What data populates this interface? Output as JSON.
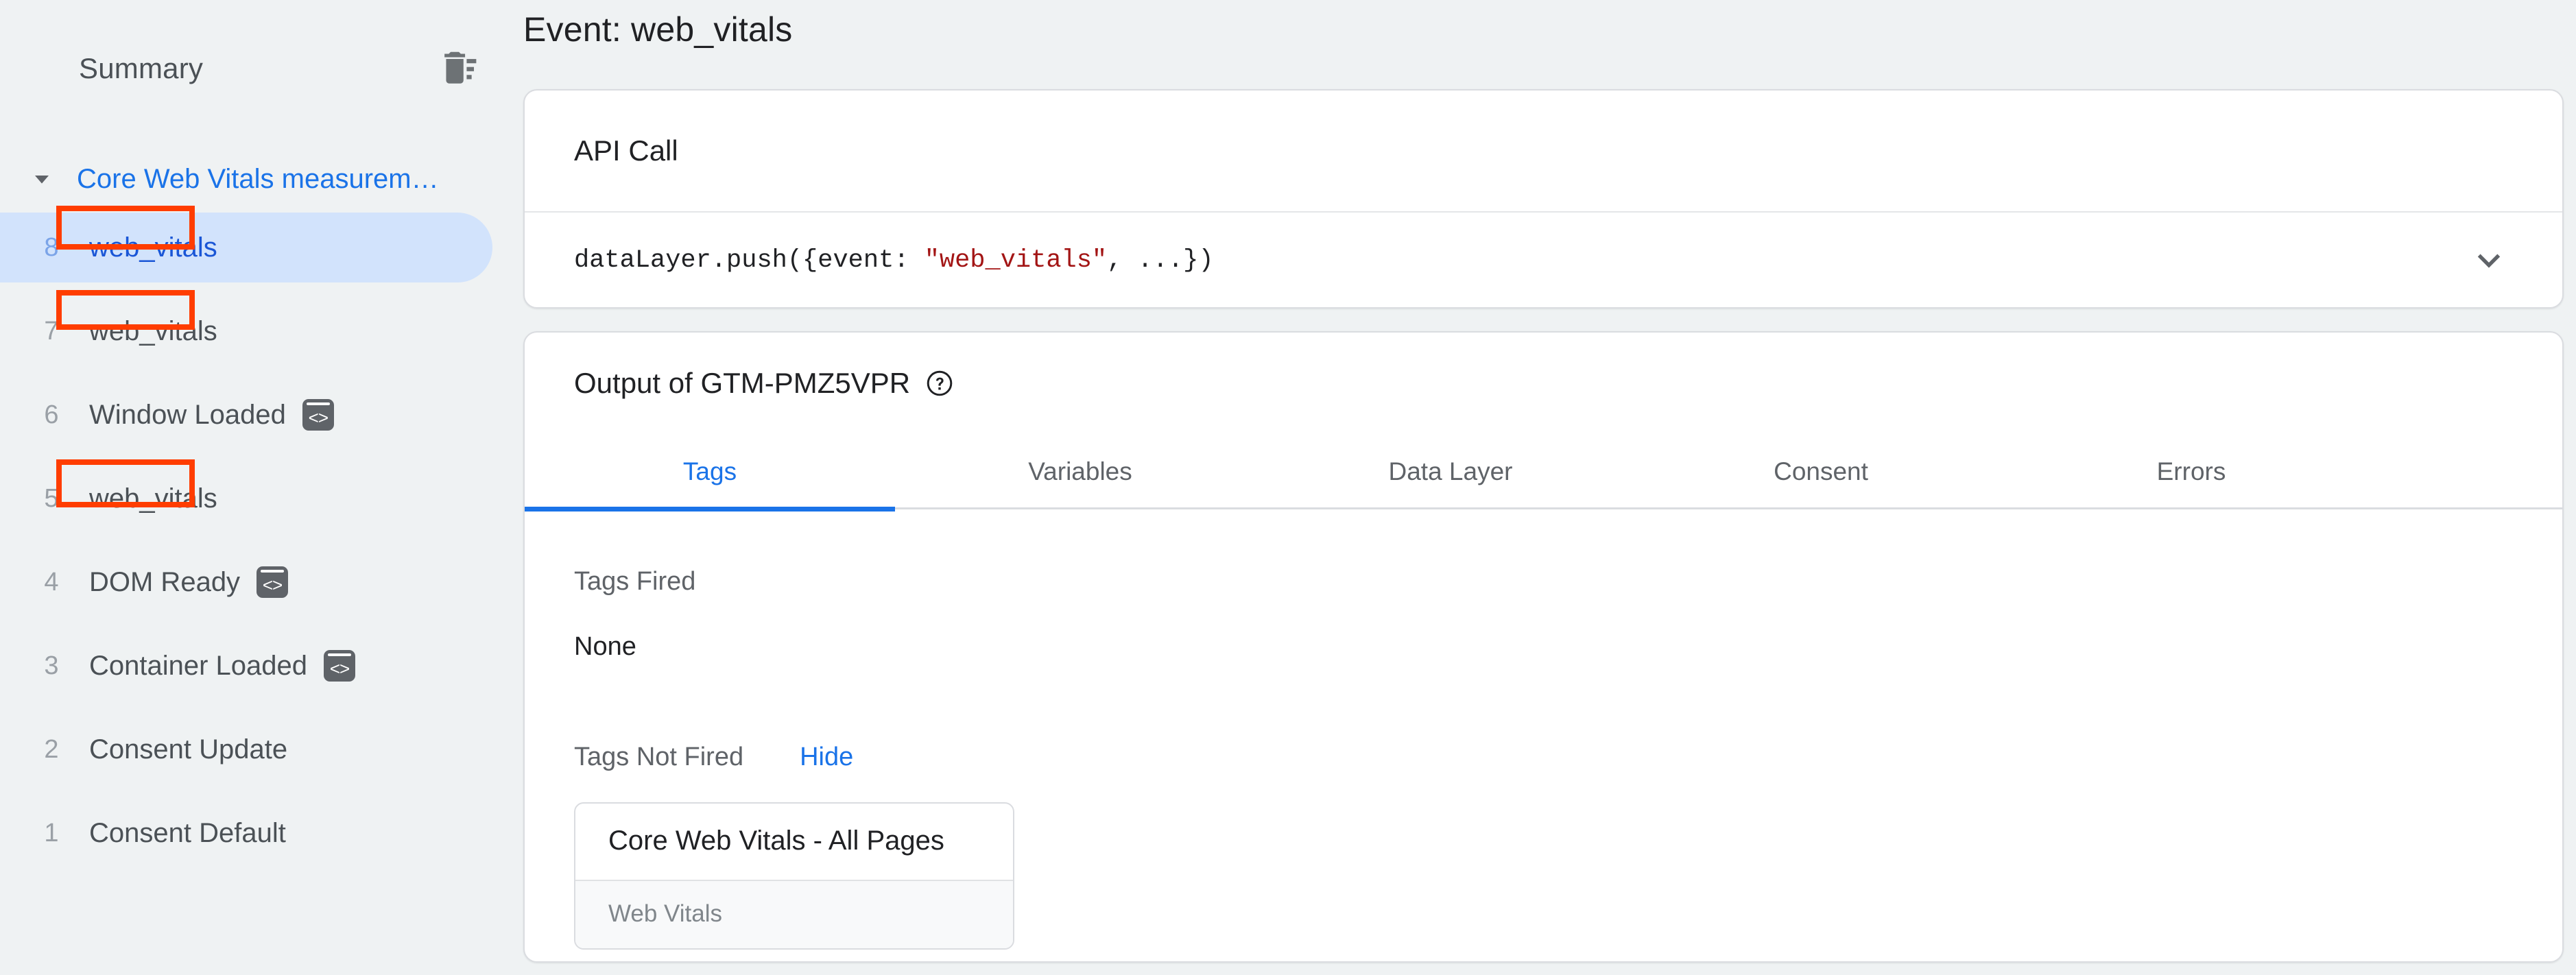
{
  "sidebar": {
    "summary_label": "Summary",
    "clear_icon": "delete-sweep-icon",
    "group": {
      "caret_icon": "caret-down-icon",
      "title": "Core Web Vitals measurem…"
    },
    "events": [
      {
        "index": "8",
        "name": "web_vitals",
        "selected": true,
        "code_icon": false,
        "highlighted": true
      },
      {
        "index": "7",
        "name": "web_vitals",
        "selected": false,
        "code_icon": false,
        "highlighted": true
      },
      {
        "index": "6",
        "name": "Window Loaded",
        "selected": false,
        "code_icon": true,
        "highlighted": false
      },
      {
        "index": "5",
        "name": "web_vitals",
        "selected": false,
        "code_icon": false,
        "highlighted": true
      },
      {
        "index": "4",
        "name": "DOM Ready",
        "selected": false,
        "code_icon": true,
        "highlighted": false
      },
      {
        "index": "3",
        "name": "Container Loaded",
        "selected": false,
        "code_icon": true,
        "highlighted": false
      },
      {
        "index": "2",
        "name": "Consent Update",
        "selected": false,
        "code_icon": false,
        "highlighted": false
      },
      {
        "index": "1",
        "name": "Consent Default",
        "selected": false,
        "code_icon": false,
        "highlighted": false
      }
    ]
  },
  "main": {
    "page_title": "Event: web_vitals",
    "api_call": {
      "heading": "API Call",
      "code_prefix": "dataLayer.push({event: ",
      "code_string": "\"web_vitals\"",
      "code_suffix": ", ...})",
      "expand_icon": "chevron-down-icon"
    },
    "output": {
      "heading": "Output of GTM-PMZ5VPR",
      "help_icon": "help-circle-icon",
      "tabs": [
        {
          "label": "Tags",
          "active": true
        },
        {
          "label": "Variables",
          "active": false
        },
        {
          "label": "Data Layer",
          "active": false
        },
        {
          "label": "Consent",
          "active": false
        },
        {
          "label": "Errors",
          "active": false
        }
      ],
      "tags_fired_label": "Tags Fired",
      "tags_fired_value": "None",
      "tags_not_fired_label": "Tags Not Fired",
      "hide_link": "Hide",
      "not_fired_tags": [
        {
          "title": "Core Web Vitals - All Pages",
          "subtitle": "Web Vitals"
        }
      ]
    }
  },
  "colors": {
    "accent_blue": "#1a73e8",
    "selected_pill": "#d2e3fc",
    "annotation_red": "#ff3d00",
    "page_bg": "#eff2f3",
    "string_red": "#a31515"
  }
}
